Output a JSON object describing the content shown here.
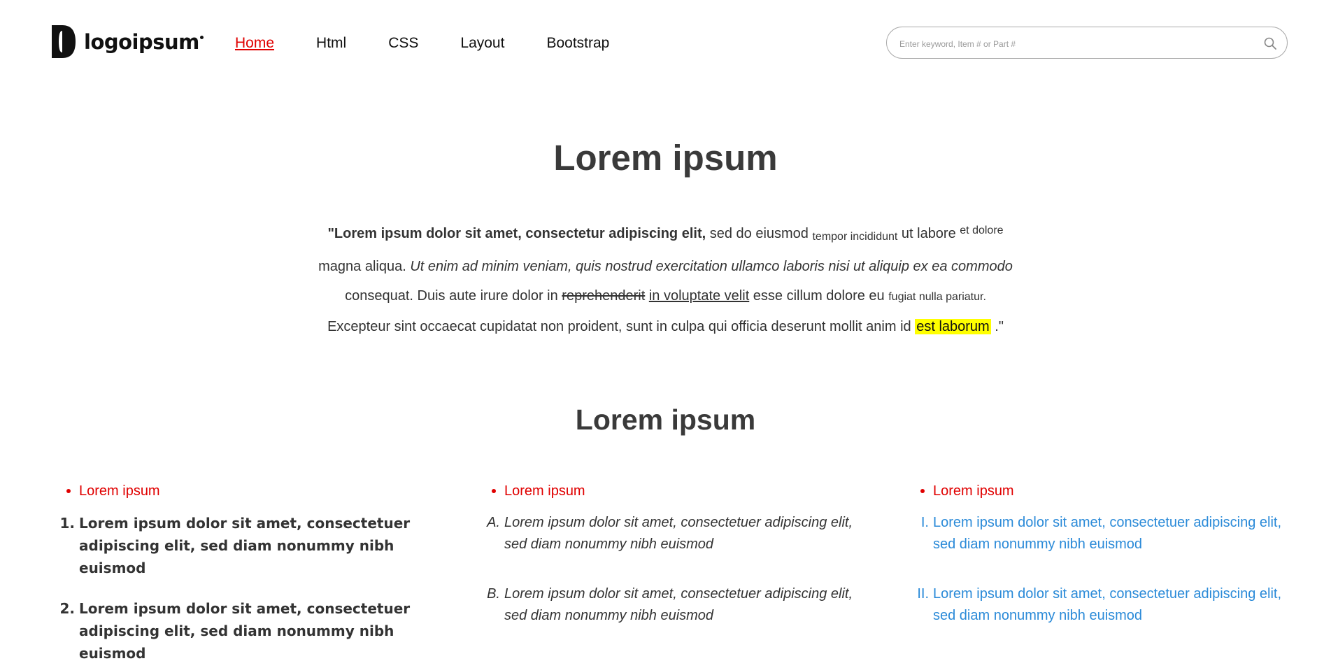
{
  "header": {
    "logo_text": "logoipsum",
    "nav": [
      "Home",
      "Html",
      "CSS",
      "Layout",
      "Bootstrap"
    ],
    "active_nav": "Home",
    "search_placeholder": "Enter keyword, Item # or Part #"
  },
  "colors": {
    "accent": "#e00000",
    "highlight": "#ffff00",
    "list_blue": "#2a8ad8",
    "text": "#333333"
  },
  "main": {
    "title": "Lorem ipsum",
    "intro": {
      "bold": "\"Lorem ipsum dolor sit amet, consectetur adipiscing elit,",
      "t1": " sed do eiusmod ",
      "sub": "tempor incididunt",
      "t2": " ut labore ",
      "sup": "et dolore",
      "t3": " magna aliqua. ",
      "italic": "Ut enim ad minim veniam, quis nostrud exercitation ullamco laboris nisi ut aliquip ex ea commodo",
      "t4": " consequat. Duis aute irure dolor in ",
      "strike": "reprehenderit",
      "t5": " ",
      "underline": "in voluptate velit",
      "t6": " esse cillum dolore eu ",
      "small": "fugiat nulla pariatur.",
      "t7": " Excepteur sint occaecat cupidatat non proident, sunt in culpa qui officia deserunt mollit anim id ",
      "highlight": "est laborum",
      "t8": " .\""
    },
    "section_title": "Lorem ipsum",
    "columns": [
      {
        "bullet": "Lorem ipsum",
        "items": [
          {
            "marker": "1.",
            "text": "Lorem ipsum dolor sit amet, consectetuer adipiscing elit, sed diam nonummy nibh euismod"
          },
          {
            "marker": "2.",
            "text": "Lorem ipsum dolor sit amet, consectetuer adipiscing elit, sed diam nonummy nibh euismod"
          }
        ]
      },
      {
        "bullet": "Lorem ipsum",
        "items": [
          {
            "marker": "A.",
            "text": "Lorem ipsum dolor sit amet, consectetuer adipiscing elit, sed diam nonummy nibh euismod"
          },
          {
            "marker": "B.",
            "text": "Lorem ipsum dolor sit amet, consectetuer adipiscing elit, sed diam nonummy nibh euismod"
          }
        ]
      },
      {
        "bullet": "Lorem ipsum",
        "items": [
          {
            "marker": "I.",
            "text": "Lorem ipsum dolor sit amet, consectetuer adipiscing elit, sed diam nonummy nibh euismod"
          },
          {
            "marker": "II.",
            "text": "Lorem ipsum dolor sit amet, consectetuer adipiscing elit, sed diam nonummy nibh euismod"
          }
        ]
      }
    ]
  }
}
